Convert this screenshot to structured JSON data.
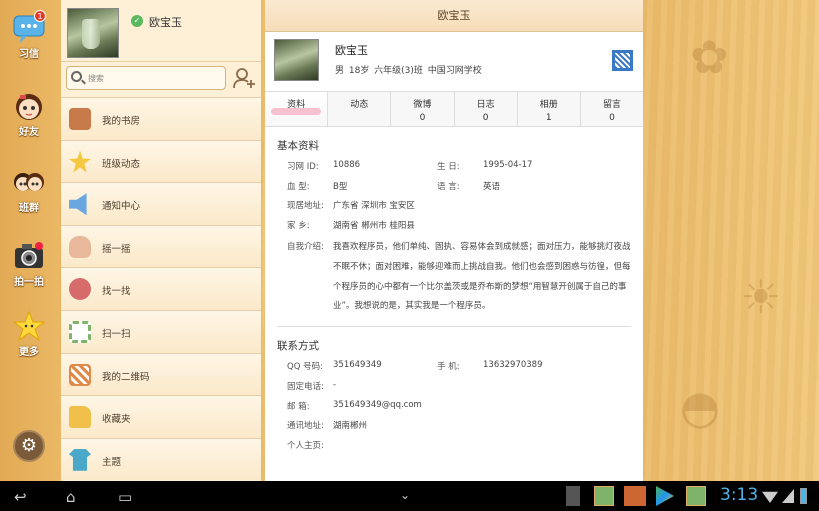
{
  "rail": {
    "items": [
      {
        "label": "习信",
        "badge": "1",
        "icon": "chat-bubble-icon"
      },
      {
        "label": "好友",
        "icon": "girl-avatar-icon"
      },
      {
        "label": "班群",
        "icon": "group-avatars-icon"
      },
      {
        "label": "拍一拍",
        "icon": "camera-icon"
      },
      {
        "label": "更多",
        "icon": "star-icon"
      }
    ],
    "settings_icon": "gear-icon"
  },
  "profile": {
    "name": "欧宝玉",
    "verified_icon": "check-circle-icon"
  },
  "search": {
    "placeholder": "搜索"
  },
  "menu": [
    {
      "label": "我的书房",
      "icon": "bookshelf-icon",
      "color": "#c77b4a"
    },
    {
      "label": "班级动态",
      "icon": "star-icon",
      "color": "#f5c842"
    },
    {
      "label": "通知中心",
      "icon": "speaker-icon",
      "color": "#6aa7e0"
    },
    {
      "label": "摇一摇",
      "icon": "hand-shake-icon",
      "color": "#e9b89b"
    },
    {
      "label": "找一找",
      "icon": "person-search-icon",
      "color": "#d76b6b"
    },
    {
      "label": "扫一扫",
      "icon": "scan-icon",
      "color": "#7fb36a"
    },
    {
      "label": "我的二维码",
      "icon": "qr-code-icon",
      "color": "#e08a4a"
    },
    {
      "label": "收藏夹",
      "icon": "folder-icon",
      "color": "#f0c04a"
    },
    {
      "label": "主题",
      "icon": "tshirt-icon",
      "color": "#4aa8c8"
    }
  ],
  "detail": {
    "header": "欧宝玉",
    "name": "欧宝玉",
    "info": "男  18岁  六年级(3)班  中国习网学校",
    "tabs": [
      {
        "label": "资料",
        "count": ""
      },
      {
        "label": "动态",
        "count": ""
      },
      {
        "label": "微博",
        "count": "0"
      },
      {
        "label": "日志",
        "count": "0"
      },
      {
        "label": "相册",
        "count": "1"
      },
      {
        "label": "留言",
        "count": "0"
      }
    ],
    "basic": {
      "title": "基本资料",
      "id_k": "习网  ID:",
      "id_v": "10886",
      "bday_k": "生    日:",
      "bday_v": "1995-04-17",
      "blood_k": "血    型:",
      "blood_v": "B型",
      "lang_k": "语    言:",
      "lang_v": "英语",
      "addr_k": "现居地址:",
      "addr_v": "广东省 深圳市 宝安区",
      "home_k": "家    乡:",
      "home_v": "湖南省 郴州市 桂阳县",
      "intro_k": "自我介绍:",
      "intro_v": "我喜欢程序员，他们单纯、固执、容易体会到成就感；面对压力，能够挑灯夜战不眠不休；面对困难，能够迎难而上挑战自我。他们也会感到困惑与彷徨，但每个程序员的心中都有一个比尔盖茨或是乔布斯的梦想“用智慧开创属于自己的事业”。我想说的是，其实我是一个程序员。"
    },
    "contact": {
      "title": "联系方式",
      "qq_k": "QQ 号码:",
      "qq_v": "351649349",
      "phone_k": "手    机:",
      "phone_v": "13632970389",
      "tel_k": "固定电话:",
      "tel_v": "-",
      "mail_k": "邮    箱:",
      "mail_v": "351649349@qq.com",
      "post_k": "通讯地址:",
      "post_v": "湖南郴州",
      "home_k": "个人主页:",
      "home_v": ""
    }
  },
  "statusbar": {
    "time": "3:13"
  }
}
